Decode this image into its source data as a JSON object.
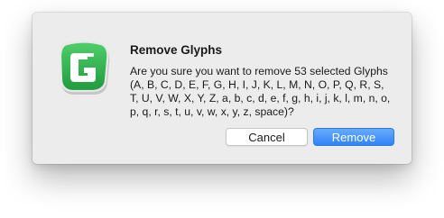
{
  "dialog": {
    "title": "Remove Glyphs",
    "message": "Are you sure you want to remove 53 selected Glyphs (A, B, C, D, E, F, G, H, I, J, K, L, M, N, O, P, Q, R, S, T, U, V, W, X, Y, Z, a, b, c, d, e, f, g, h, i, j, k, l, m, n, o, p, q, r, s, t, u, v, w, x, y, z, space)?",
    "icon": "glyphs-app-icon",
    "icon_letter": "G",
    "buttons": {
      "cancel_label": "Cancel",
      "remove_label": "Remove"
    }
  },
  "colors": {
    "dialog_background": "#ececec",
    "icon_green": "#2bb34a",
    "primary_button": "#3a8ef7"
  }
}
